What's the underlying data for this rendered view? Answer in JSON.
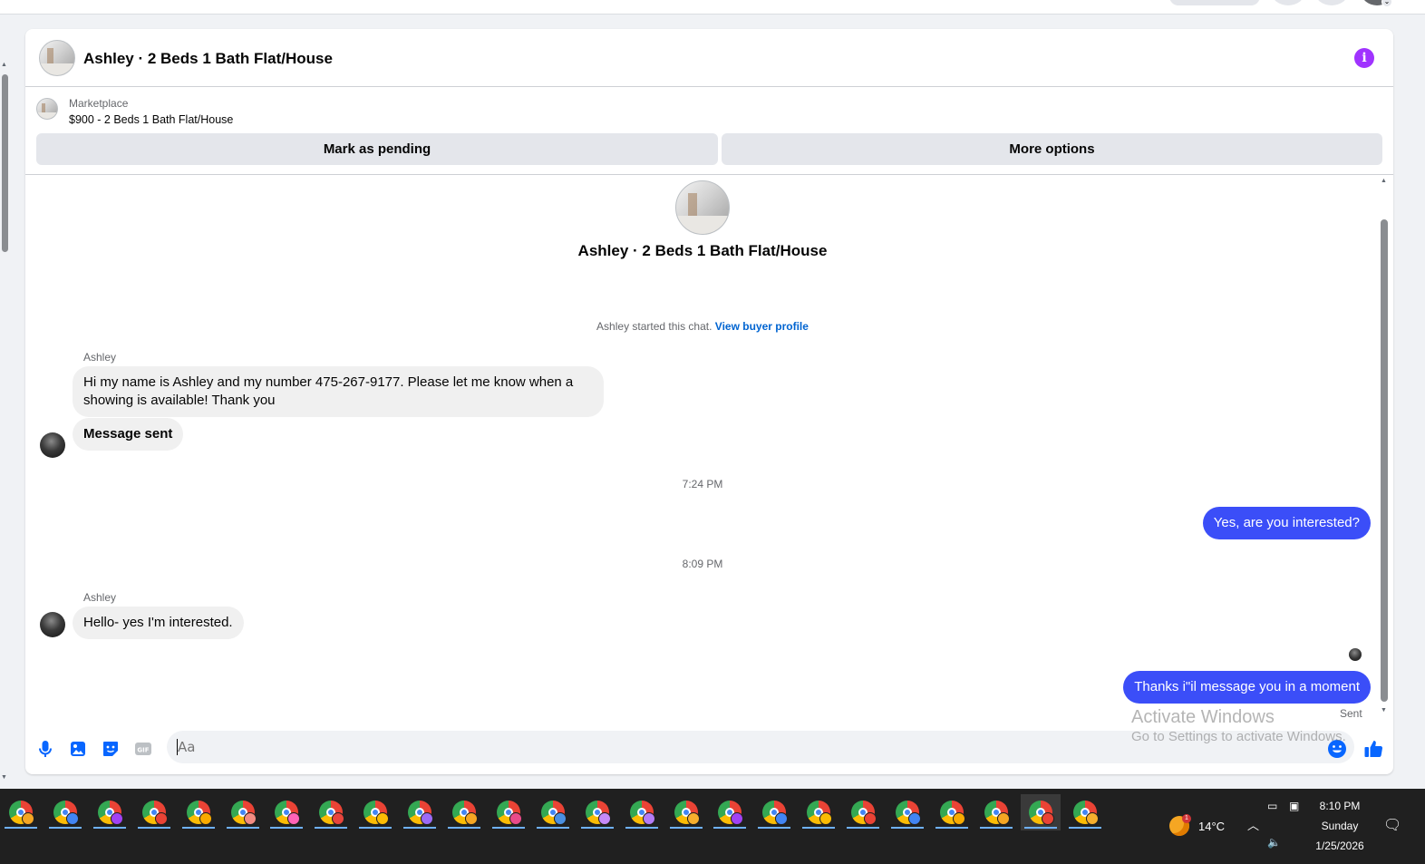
{
  "conversation": {
    "title": "Ashley · 2 Beds 1 Bath Flat/House",
    "info_icon": "info-icon"
  },
  "marketplace": {
    "label": "Marketplace",
    "listing": "$900 - 2 Beds 1 Bath Flat/House",
    "mark_pending": "Mark as pending",
    "more_options": "More options"
  },
  "chat": {
    "title": "Ashley · 2 Beds 1 Bath Flat/House",
    "started_text": "Ashley started this chat.",
    "view_profile": "View buyer profile",
    "messages": [
      {
        "sender": "Ashley",
        "text": "Hi my name is Ashley and my number 475-267-9177. Please let me know when a showing is available! Thank you"
      },
      {
        "text": "Message sent"
      },
      {
        "timestamp": "7:24 PM"
      },
      {
        "text": "Yes, are you interested?"
      },
      {
        "timestamp": "8:09 PM"
      },
      {
        "sender": "Ashley",
        "text": "Hello- yes I'm interested."
      },
      {
        "text": "Thanks i\"il message you in a moment"
      }
    ],
    "sent_label": "Sent"
  },
  "composer": {
    "placeholder": "Aa",
    "icons": [
      "microphone-icon",
      "photo-icon",
      "sticker-icon",
      "gif-icon",
      "emoji-icon",
      "like-icon"
    ]
  },
  "watermark": {
    "line1": "Activate Windows",
    "line2": "Go to Settings to activate Windows."
  },
  "taskbar": {
    "apps_count_label": "",
    "weather": "14°C",
    "weather_badge": "1",
    "time": "8:10 PM",
    "day": "Sunday",
    "date": "1/25/2026"
  },
  "colors": {
    "outgoing_bubble": "#3b4ef8",
    "incoming_bubble": "#f0f0f0",
    "accent_blue": "#0064d1",
    "info_purple": "#a033ff",
    "composer_icons": "#0866ff"
  }
}
